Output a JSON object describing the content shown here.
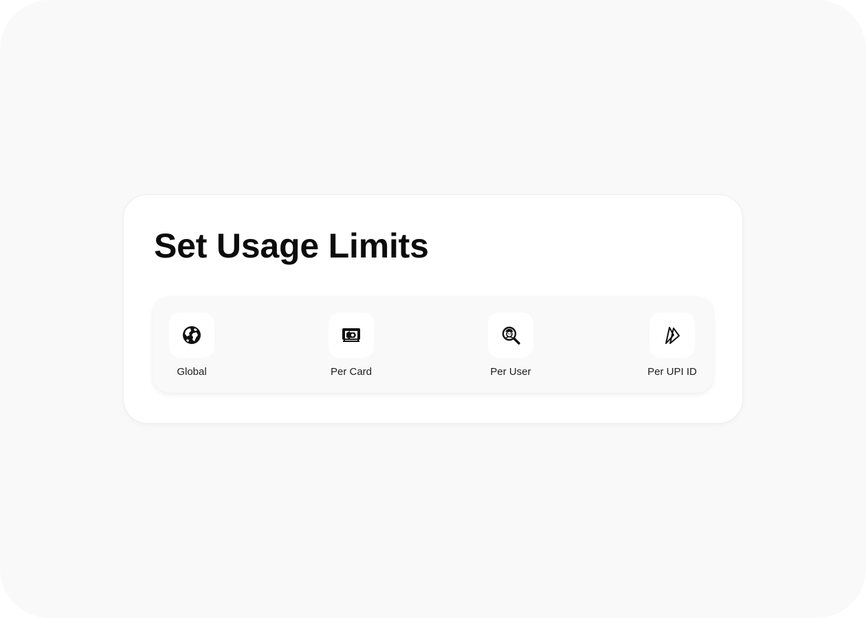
{
  "card": {
    "title": "Set Usage Limits"
  },
  "options": [
    {
      "label": "Global",
      "icon": "globe-icon"
    },
    {
      "label": "Per Card",
      "icon": "card-icon"
    },
    {
      "label": "Per User",
      "icon": "user-search-icon"
    },
    {
      "label": "Per UPI ID",
      "icon": "upi-icon"
    }
  ],
  "colors": {
    "background": "#f9f9f9",
    "card": "#ffffff",
    "text": "#0c0c0c"
  }
}
